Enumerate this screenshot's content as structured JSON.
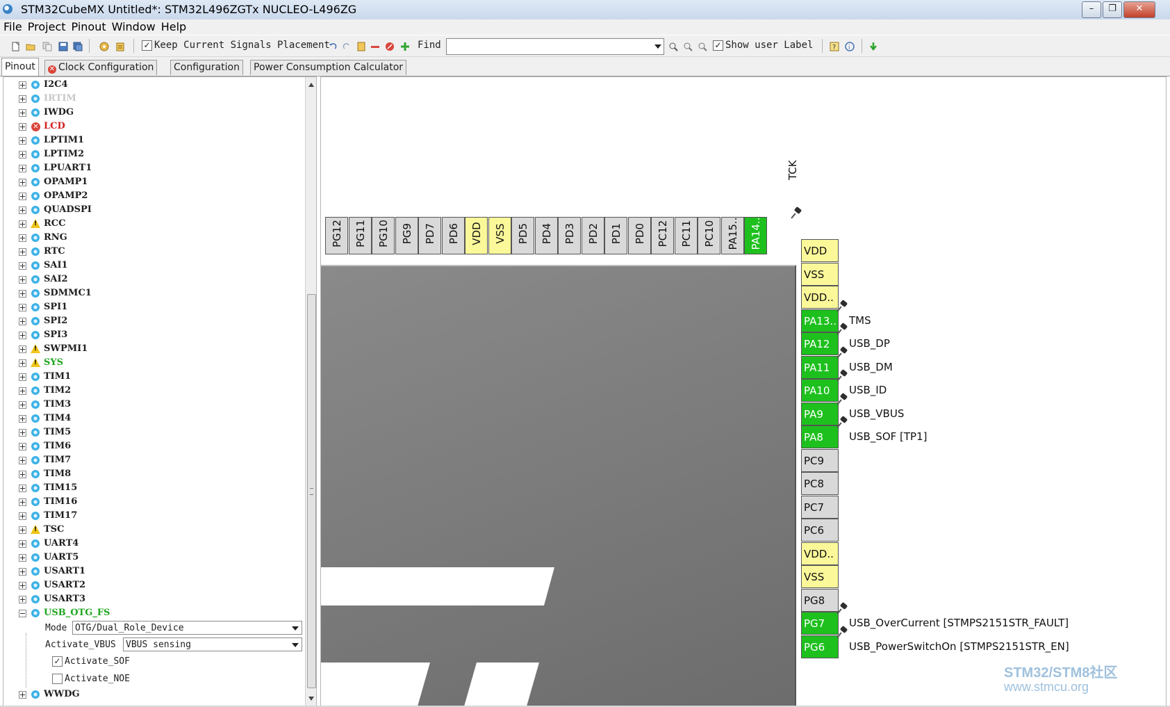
{
  "window": {
    "title": "STM32CubeMX Untitled*: STM32L496ZGTx NUCLEO-L496ZG",
    "controls": {
      "minimize": "–",
      "maximize": "❐",
      "close": "✕"
    }
  },
  "menu": [
    "File",
    "Project",
    "Pinout",
    "Window",
    "Help"
  ],
  "toolbar": {
    "keep_signals_label": "Keep Current Signals Placement",
    "keep_signals_checked": "✓",
    "find_label": "Find",
    "find_value": "",
    "show_user_label": "Show user Label",
    "show_user_checked": "✓"
  },
  "tabs": [
    {
      "label": "Pinout",
      "active": true
    },
    {
      "label": "Clock Configuration",
      "icon": "error-icon"
    },
    {
      "label": "Configuration"
    },
    {
      "label": "Power Consumption Calculator"
    }
  ],
  "tree": {
    "items": [
      {
        "label": "I2C4",
        "icon": "gear-icon",
        "state": "normal"
      },
      {
        "label": "IRTIM",
        "icon": "gear-icon",
        "state": "disabled"
      },
      {
        "label": "IWDG",
        "icon": "gear-icon",
        "state": "normal"
      },
      {
        "label": "LCD",
        "icon": "error-icon",
        "state": "error"
      },
      {
        "label": "LPTIM1",
        "icon": "gear-icon",
        "state": "normal"
      },
      {
        "label": "LPTIM2",
        "icon": "gear-icon",
        "state": "normal"
      },
      {
        "label": "LPUART1",
        "icon": "gear-icon",
        "state": "normal"
      },
      {
        "label": "OPAMP1",
        "icon": "gear-icon",
        "state": "normal"
      },
      {
        "label": "OPAMP2",
        "icon": "gear-icon",
        "state": "normal"
      },
      {
        "label": "QUADSPI",
        "icon": "gear-icon",
        "state": "normal"
      },
      {
        "label": "RCC",
        "icon": "warning-icon",
        "state": "normal"
      },
      {
        "label": "RNG",
        "icon": "gear-icon",
        "state": "normal"
      },
      {
        "label": "RTC",
        "icon": "gear-icon",
        "state": "normal"
      },
      {
        "label": "SAI1",
        "icon": "gear-icon",
        "state": "normal"
      },
      {
        "label": "SAI2",
        "icon": "gear-icon",
        "state": "normal"
      },
      {
        "label": "SDMMC1",
        "icon": "gear-icon",
        "state": "normal"
      },
      {
        "label": "SPI1",
        "icon": "gear-icon",
        "state": "normal"
      },
      {
        "label": "SPI2",
        "icon": "gear-icon",
        "state": "normal"
      },
      {
        "label": "SPI3",
        "icon": "gear-icon",
        "state": "normal"
      },
      {
        "label": "SWPMI1",
        "icon": "warning-icon",
        "state": "normal"
      },
      {
        "label": "SYS",
        "icon": "warning-icon",
        "state": "active"
      },
      {
        "label": "TIM1",
        "icon": "gear-icon",
        "state": "normal"
      },
      {
        "label": "TIM2",
        "icon": "gear-icon",
        "state": "normal"
      },
      {
        "label": "TIM3",
        "icon": "gear-icon",
        "state": "normal"
      },
      {
        "label": "TIM4",
        "icon": "gear-icon",
        "state": "normal"
      },
      {
        "label": "TIM5",
        "icon": "gear-icon",
        "state": "normal"
      },
      {
        "label": "TIM6",
        "icon": "gear-icon",
        "state": "normal"
      },
      {
        "label": "TIM7",
        "icon": "gear-icon",
        "state": "normal"
      },
      {
        "label": "TIM8",
        "icon": "gear-icon",
        "state": "normal"
      },
      {
        "label": "TIM15",
        "icon": "gear-icon",
        "state": "normal"
      },
      {
        "label": "TIM16",
        "icon": "gear-icon",
        "state": "normal"
      },
      {
        "label": "TIM17",
        "icon": "gear-icon",
        "state": "normal"
      },
      {
        "label": "TSC",
        "icon": "warning-icon",
        "state": "normal"
      },
      {
        "label": "UART4",
        "icon": "gear-icon",
        "state": "normal"
      },
      {
        "label": "UART5",
        "icon": "gear-icon",
        "state": "normal"
      },
      {
        "label": "USART1",
        "icon": "gear-icon",
        "state": "normal"
      },
      {
        "label": "USART2",
        "icon": "gear-icon",
        "state": "normal"
      },
      {
        "label": "USART3",
        "icon": "gear-icon",
        "state": "normal"
      },
      {
        "label": "USB_OTG_FS",
        "icon": "gear-icon",
        "state": "active",
        "expanded": true
      }
    ],
    "usb_props": {
      "mode_label": "Mode",
      "mode_value": "OTG/Dual_Role_Device",
      "vbus_label": "Activate_VBUS",
      "vbus_value": "VBUS sensing",
      "sof_label": "Activate_SOF",
      "sof_checked": "✓",
      "noe_label": "Activate_NOE",
      "noe_checked": ""
    },
    "last_item": {
      "label": "WWDG",
      "icon": "gear-icon",
      "state": "normal"
    }
  },
  "chip": {
    "top_pins": [
      {
        "label": "PG12",
        "color": "grey"
      },
      {
        "label": "PG11",
        "color": "grey"
      },
      {
        "label": "PG10",
        "color": "grey"
      },
      {
        "label": "PG9",
        "color": "grey"
      },
      {
        "label": "PD7",
        "color": "grey"
      },
      {
        "label": "PD6",
        "color": "grey"
      },
      {
        "label": "VDD",
        "color": "yellow"
      },
      {
        "label": "VSS",
        "color": "yellow"
      },
      {
        "label": "PD5",
        "color": "grey"
      },
      {
        "label": "PD4",
        "color": "grey"
      },
      {
        "label": "PD3",
        "color": "grey"
      },
      {
        "label": "PD2",
        "color": "grey"
      },
      {
        "label": "PD1",
        "color": "grey"
      },
      {
        "label": "PD0",
        "color": "grey"
      },
      {
        "label": "PC12",
        "color": "grey"
      },
      {
        "label": "PC11",
        "color": "grey"
      },
      {
        "label": "PC10",
        "color": "grey"
      },
      {
        "label": "PA15..",
        "color": "grey"
      },
      {
        "label": "PA14..",
        "color": "green",
        "signal": "TCK"
      }
    ],
    "right_pins": [
      {
        "label": "VDD",
        "color": "yellow",
        "signal": ""
      },
      {
        "label": "VSS",
        "color": "yellow",
        "signal": ""
      },
      {
        "label": "VDD..",
        "color": "yellow",
        "signal": ""
      },
      {
        "label": "PA13..",
        "color": "green",
        "signal": "TMS"
      },
      {
        "label": "PA12",
        "color": "green",
        "signal": "USB_DP"
      },
      {
        "label": "PA11",
        "color": "green",
        "signal": "USB_DM"
      },
      {
        "label": "PA10",
        "color": "green",
        "signal": "USB_ID"
      },
      {
        "label": "PA9",
        "color": "green",
        "signal": "USB_VBUS"
      },
      {
        "label": "PA8",
        "color": "green",
        "signal": "USB_SOF [TP1]"
      },
      {
        "label": "PC9",
        "color": "grey",
        "signal": ""
      },
      {
        "label": "PC8",
        "color": "grey",
        "signal": ""
      },
      {
        "label": "PC7",
        "color": "grey",
        "signal": ""
      },
      {
        "label": "PC6",
        "color": "grey",
        "signal": ""
      },
      {
        "label": "VDD..",
        "color": "yellow",
        "signal": ""
      },
      {
        "label": "VSS",
        "color": "yellow",
        "signal": ""
      },
      {
        "label": "PG8",
        "color": "grey",
        "signal": ""
      },
      {
        "label": "PG7",
        "color": "green",
        "signal": "USB_OverCurrent [STMPS2151STR_FAULT]"
      },
      {
        "label": "PG6",
        "color": "green",
        "signal": "USB_PowerSwitchOn [STMPS2151STR_EN]"
      }
    ]
  },
  "watermark": {
    "line1": "STM32/STM8社区",
    "line2": "www.stmcu.org"
  },
  "colors": {
    "pin_green": "#1ec01e",
    "pin_yellow": "#fbf89a",
    "pin_grey": "#d9d9d9",
    "error_red": "#d02020",
    "active_green": "#1fa51f"
  }
}
